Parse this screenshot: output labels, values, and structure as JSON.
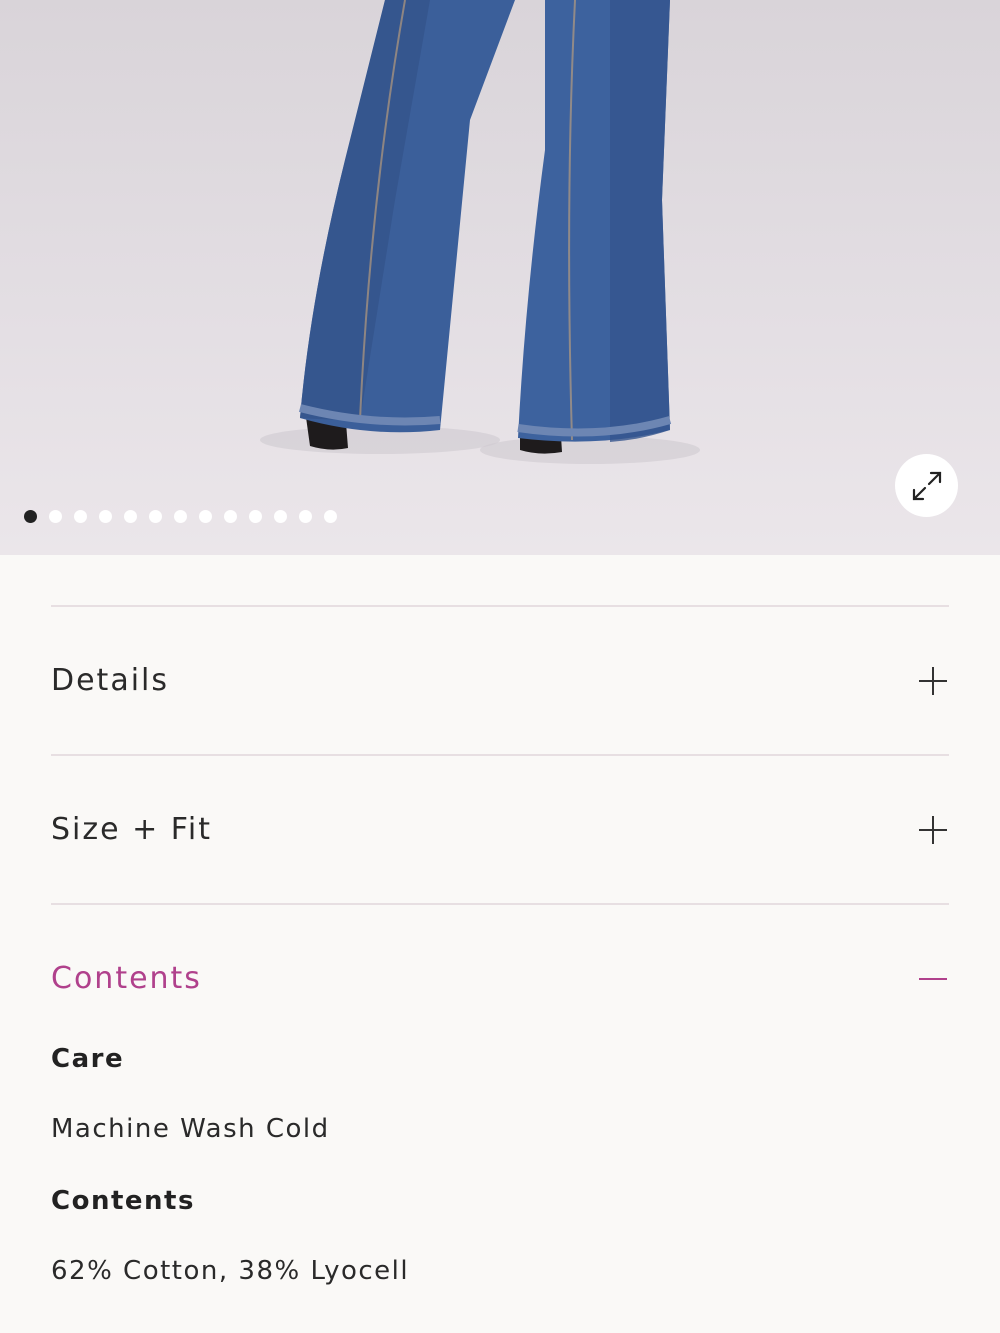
{
  "gallery": {
    "image_alt": "Model wearing wide-leg blue denim jeans with black boots",
    "dot_count": 13,
    "active_index": 0,
    "expand_icon": "expand-arrows-icon"
  },
  "accordion": {
    "sections": [
      {
        "label": "Details",
        "state": "collapsed",
        "icon": "plus-icon"
      },
      {
        "label": "Size + Fit",
        "state": "collapsed",
        "icon": "plus-icon"
      },
      {
        "label": "Contents",
        "state": "expanded",
        "icon": "minus-icon"
      }
    ],
    "contents_body": {
      "care_heading": "Care",
      "care_text": "Machine Wash Cold",
      "contents_heading": "Contents",
      "contents_text": "62% Cotton, 38% Lyocell"
    }
  },
  "colors": {
    "accent": "#b0418c",
    "background": "#faf9f7",
    "divider": "#e7dfe2"
  }
}
